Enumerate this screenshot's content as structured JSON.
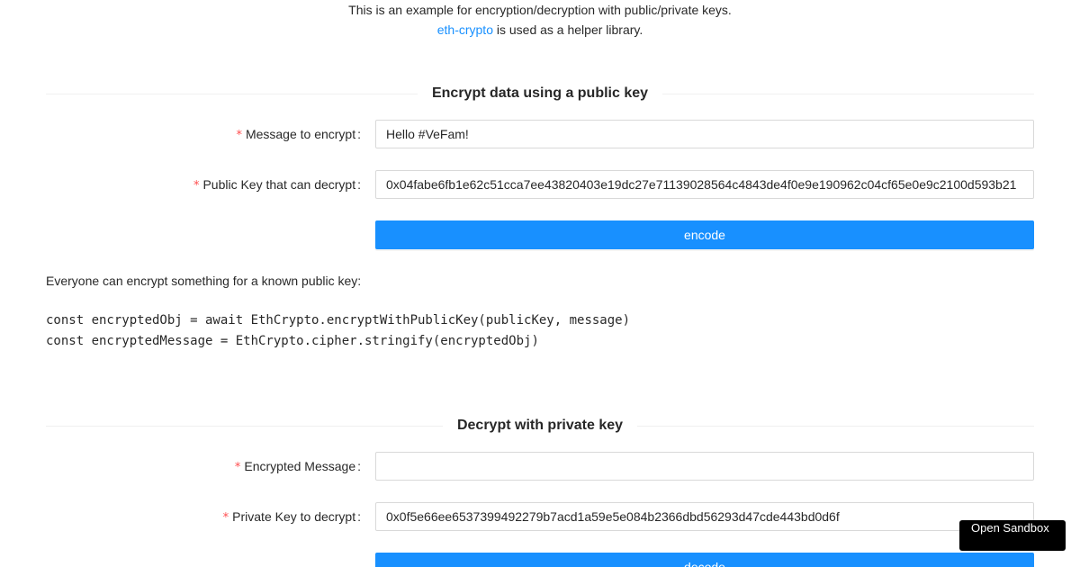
{
  "intro": {
    "line1": "This is an example for encryption/decryption with public/private keys.",
    "link_text": "eth-crypto",
    "line2_rest": " is used as a helper library."
  },
  "encrypt_section": {
    "title": "Encrypt data using a public key",
    "message_label": "Message to encrypt",
    "message_value": "Hello #VeFam!",
    "pubkey_label": "Public Key that can decrypt",
    "pubkey_value": "0x04fabe6fb1e62c51cca7ee43820403e19dc27e71139028564c4843de4f0e9e190962c04cf65e0e9c2100d593b21",
    "button_label": "encode",
    "note": "Everyone can encrypt something for a known public key:",
    "code_line1": "const encryptedObj = await EthCrypto.encryptWithPublicKey(publicKey, message)",
    "code_line2": "const encryptedMessage = EthCrypto.cipher.stringify(encryptedObj)"
  },
  "decrypt_section": {
    "title": "Decrypt with private key",
    "encrypted_label": "Encrypted Message",
    "encrypted_value": "",
    "privkey_label": "Private Key to decrypt",
    "privkey_value": "0x0f5e66ee6537399492279b7acd1a59e5e084b2366dbd56293d47cde443bd0d6f",
    "button_label": "decode"
  },
  "required_mark": "*",
  "colon": ":",
  "sandbox_label": "Open Sandbox",
  "colors": {
    "primary": "#1890ff",
    "required": "#ff4d4f",
    "divider": "#f0f0f0"
  }
}
